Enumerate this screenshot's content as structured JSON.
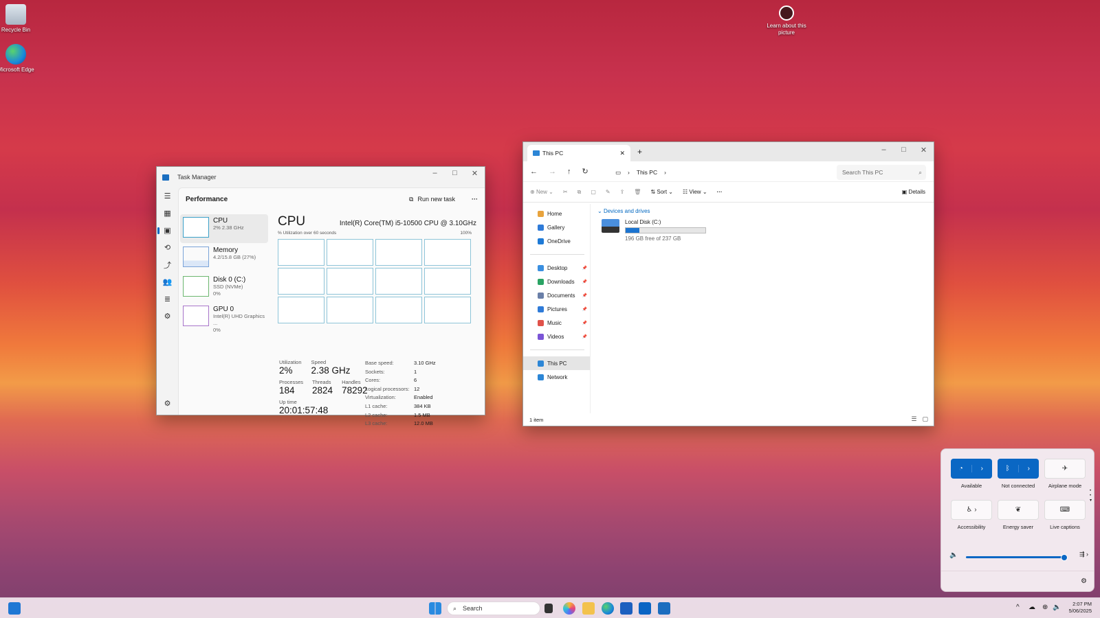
{
  "desktop": {
    "icons": [
      {
        "label": "Recycle Bin"
      },
      {
        "label": "Microsoft Edge"
      }
    ],
    "spotlight": {
      "label": "Learn about this picture"
    }
  },
  "task_manager": {
    "title": "Task Manager",
    "section": "Performance",
    "run_new_task": "Run new task",
    "items": [
      {
        "name": "CPU",
        "sub1": "2% 2.38 GHz",
        "sub2": ""
      },
      {
        "name": "Memory",
        "sub1": "4.2/15.8 GB (27%)",
        "sub2": ""
      },
      {
        "name": "Disk 0 (C:)",
        "sub1": "SSD (NVMe)",
        "sub2": "0%"
      },
      {
        "name": "GPU 0",
        "sub1": "Intel(R) UHD Graphics ...",
        "sub2": "0%"
      }
    ],
    "cpu": {
      "heading": "CPU",
      "model": "Intel(R) Core(TM) i5-10500 CPU @ 3.10GHz",
      "graph_label": "% Utilization over 60 seconds",
      "graph_max": "100%",
      "utilization_label": "Utilization",
      "utilization": "2%",
      "speed_label": "Speed",
      "speed": "2.38 GHz",
      "processes_label": "Processes",
      "processes": "184",
      "threads_label": "Threads",
      "threads": "2824",
      "handles_label": "Handles",
      "handles": "78292",
      "uptime_label": "Up time",
      "uptime": "20:01:57:48",
      "specs": [
        {
          "k": "Base speed:",
          "v": "3.10 GHz"
        },
        {
          "k": "Sockets:",
          "v": "1"
        },
        {
          "k": "Cores:",
          "v": "6"
        },
        {
          "k": "Logical processors:",
          "v": "12"
        },
        {
          "k": "Virtualization:",
          "v": "Enabled"
        },
        {
          "k": "L1 cache:",
          "v": "384 KB"
        },
        {
          "k": "L2 cache:",
          "v": "1.5 MB"
        },
        {
          "k": "L3 cache:",
          "v": "12.0 MB"
        }
      ]
    }
  },
  "explorer": {
    "tab_title": "This PC",
    "address": "This PC",
    "search_placeholder": "Search This PC",
    "toolbar": {
      "new": "New",
      "sort": "Sort",
      "view": "View",
      "details": "Details"
    },
    "nav": [
      {
        "label": "Home",
        "color": "#e8a33d",
        "pinned": false
      },
      {
        "label": "Gallery",
        "color": "#2f7bd8",
        "pinned": false
      },
      {
        "label": "OneDrive",
        "color": "#1e7ad6",
        "pinned": false
      },
      {
        "label": "Desktop",
        "color": "#3a8fe0",
        "pinned": true
      },
      {
        "label": "Downloads",
        "color": "#2aa364",
        "pinned": true
      },
      {
        "label": "Documents",
        "color": "#6a7fa8",
        "pinned": true
      },
      {
        "label": "Pictures",
        "color": "#2f7bd8",
        "pinned": true
      },
      {
        "label": "Music",
        "color": "#e0524a",
        "pinned": true
      },
      {
        "label": "Videos",
        "color": "#7b55d6",
        "pinned": true
      },
      {
        "label": "This PC",
        "color": "#2c86d6",
        "pinned": false
      },
      {
        "label": "Network",
        "color": "#2c86d6",
        "pinned": false
      }
    ],
    "group": "Devices and drives",
    "drive": {
      "name": "Local Disk (C:)",
      "free": "196 GB free of 237 GB",
      "used_fraction": 0.173
    },
    "status": "1 item"
  },
  "quick_settings": {
    "tiles": [
      {
        "label": "Available"
      },
      {
        "label": "Not connected"
      },
      {
        "label": "Airplane mode"
      },
      {
        "label": "Accessibility"
      },
      {
        "label": "Energy saver"
      },
      {
        "label": "Live captions"
      }
    ],
    "volume_fraction": 0.98
  },
  "taskbar": {
    "search": "Search",
    "time": "2:07 PM",
    "date": "5/06/2025"
  }
}
